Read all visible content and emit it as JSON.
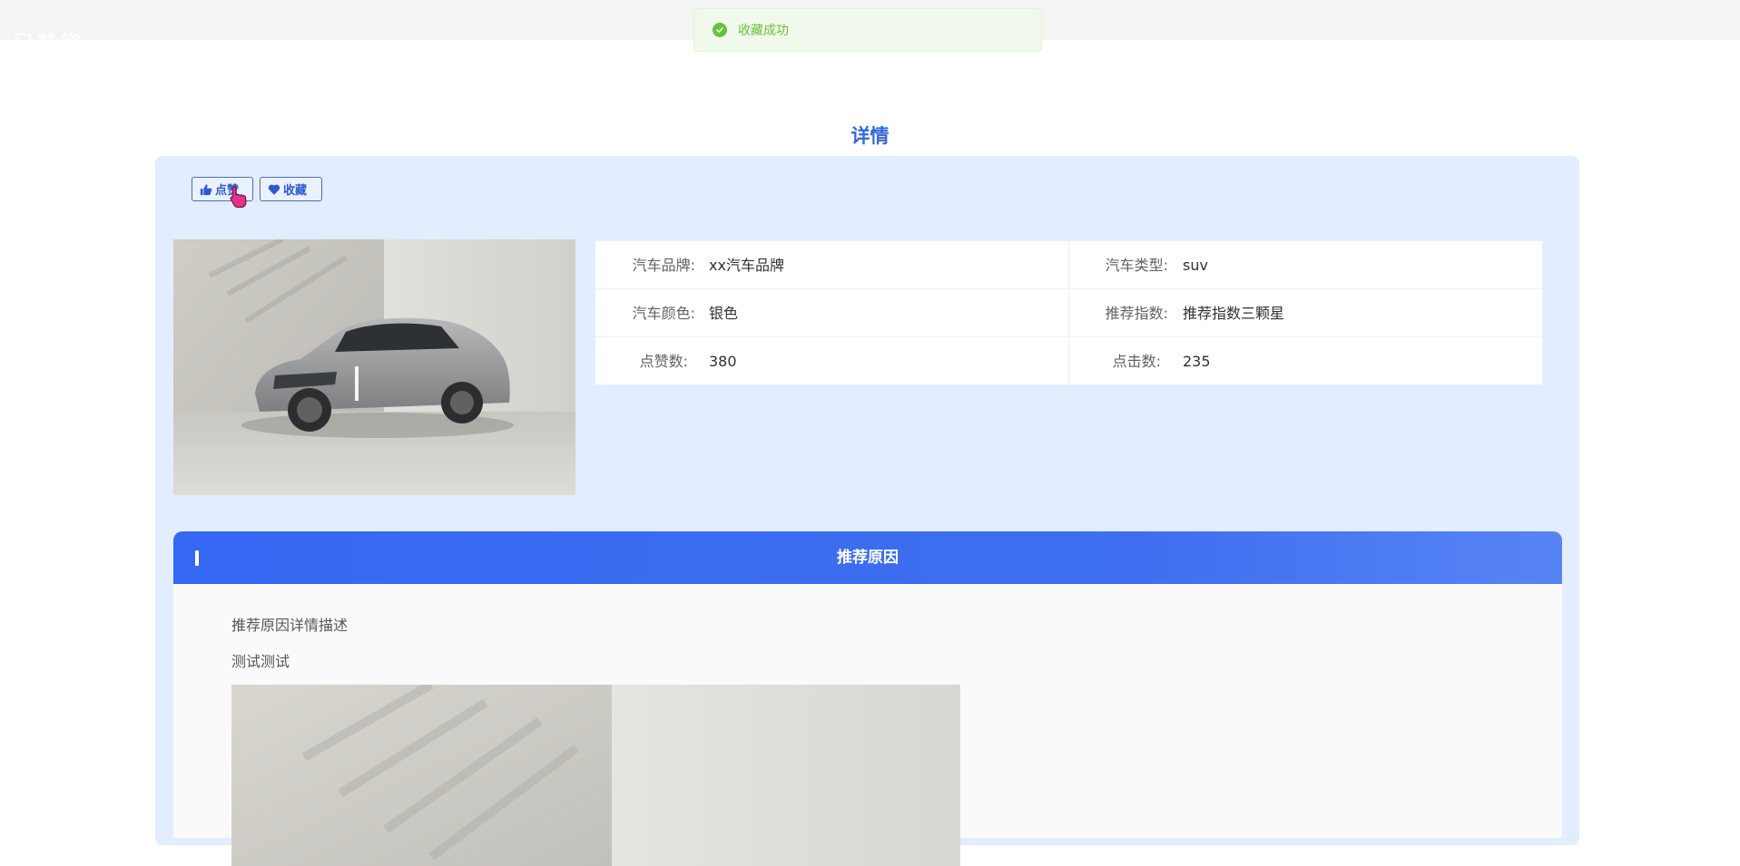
{
  "topbar": {
    "ghost_text": "已赞赏"
  },
  "toast": {
    "message": "收藏成功",
    "color": "#67c23a"
  },
  "page": {
    "title": "详情"
  },
  "actions": {
    "like_label": "点赞",
    "favorite_label": "收藏"
  },
  "info": {
    "rows": [
      {
        "left_label": "汽车品牌:",
        "left_value": "xx汽车品牌",
        "right_label": "汽车类型:",
        "right_value": "suv"
      },
      {
        "left_label": "汽车颜色:",
        "left_value": "银色",
        "right_label": "推荐指数:",
        "right_value": "推荐指数三颗星"
      },
      {
        "left_label": "点赞数:",
        "left_value": "380",
        "right_label": "点击数:",
        "right_value": "235"
      }
    ]
  },
  "section": {
    "title": "推荐原因",
    "lines": [
      "推荐原因详情描述",
      "测试测试"
    ]
  },
  "colors": {
    "accent": "#3366dd",
    "card_bg": "#e2edff",
    "header_blue": "#3468f2"
  }
}
